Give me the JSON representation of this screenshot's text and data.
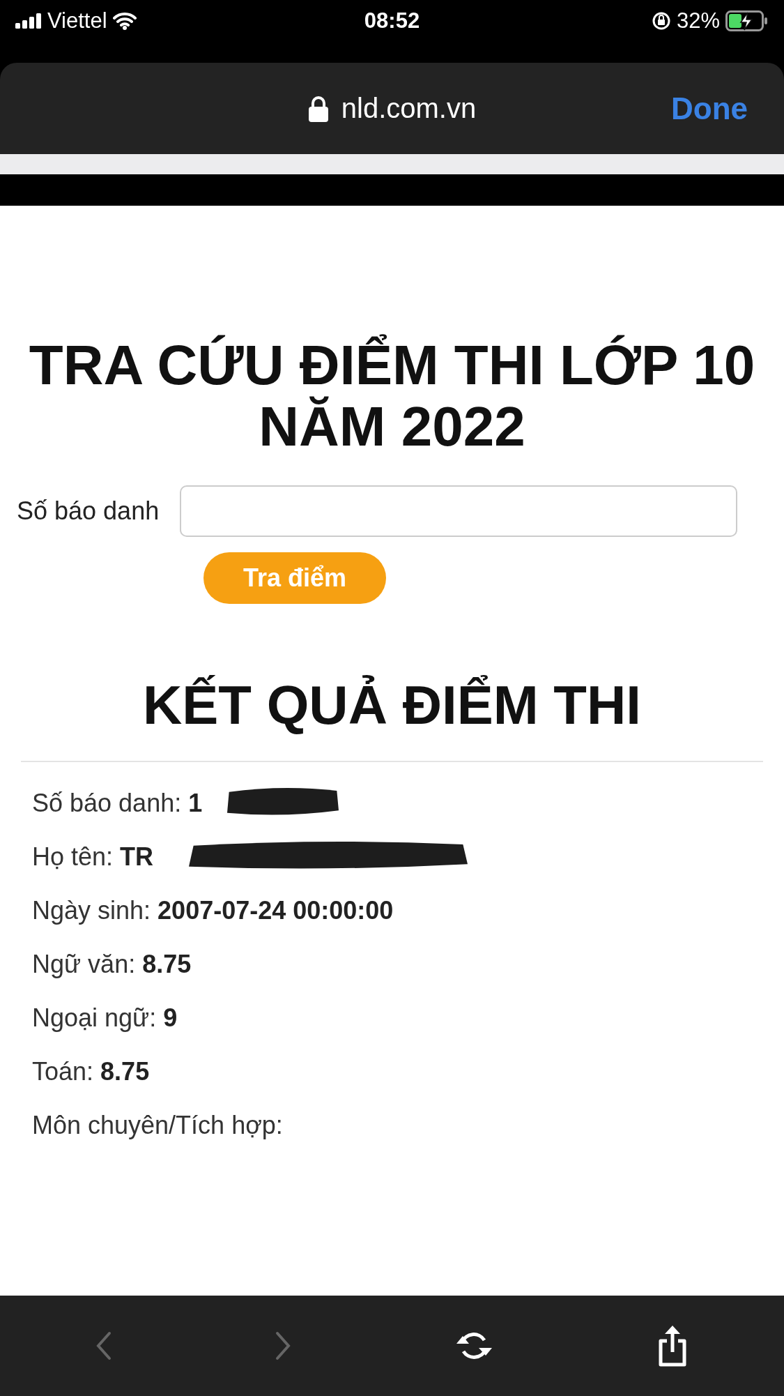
{
  "status_bar": {
    "carrier": "Viettel",
    "time": "08:52",
    "battery": "32%"
  },
  "browser": {
    "url": "nld.com.vn",
    "done": "Done"
  },
  "page": {
    "title_lines": [
      "TRA CỨU ĐIỂM THI LỚP 10",
      "NĂM 2022"
    ],
    "search": {
      "label": "Số báo danh",
      "button": "Tra điểm"
    },
    "result_title": "KẾT QUẢ ĐIỂM THI",
    "fields": [
      {
        "label": "Số báo danh:",
        "value": "1",
        "redacted": true
      },
      {
        "label": "Họ tên:",
        "value": "TR",
        "redacted": true
      },
      {
        "label": "Ngày sinh:",
        "value": "2007-07-24 00:00:00",
        "redacted": false
      },
      {
        "label": "Ngữ văn:",
        "value": "8.75",
        "redacted": false
      },
      {
        "label": "Ngoại ngữ:",
        "value": "9",
        "redacted": false
      },
      {
        "label": "Toán:",
        "value": "8.75",
        "redacted": false
      },
      {
        "label": "Môn chuyên/Tích hợp:",
        "redacted": false
      }
    ]
  },
  "toolbar": [
    {
      "kind": "back",
      "disabled": true
    },
    {
      "kind": "forward",
      "disabled": true
    },
    {
      "kind": "reload",
      "disabled": false
    },
    {
      "kind": "share",
      "disabled": false
    }
  ]
}
